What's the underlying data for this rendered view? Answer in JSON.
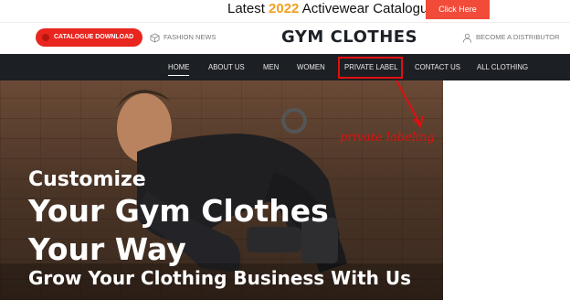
{
  "promo": {
    "text_before": "Latest ",
    "year": "2022",
    "text_after": " Activewear Catalogue",
    "button_label": "Click Here"
  },
  "header": {
    "catalogue_button": "CATALOGUE DOWNLOAD",
    "fashion_news": "FASHION NEWS",
    "logo": "GYM CLOTHES",
    "distributor": "BECOME A DISTRIBUTOR"
  },
  "nav": {
    "items": [
      "HOME",
      "ABOUT US",
      "MEN",
      "WOMEN",
      "PRIVATE LABEL",
      "CONTACT US",
      "ALL CLOTHING"
    ],
    "active": "HOME"
  },
  "annotation": "private labeling",
  "hero": {
    "line1": "Customize",
    "line2": "Your Gym Clothes",
    "line3": "Your Way",
    "line4": "Grow Your Clothing Business With Us"
  },
  "colors": {
    "accent_red": "#e8261f",
    "promo_button": "#f24b3a",
    "year_highlight": "#f0a020",
    "nav_background": "#1c1f24",
    "annotation_red": "#e01010"
  }
}
